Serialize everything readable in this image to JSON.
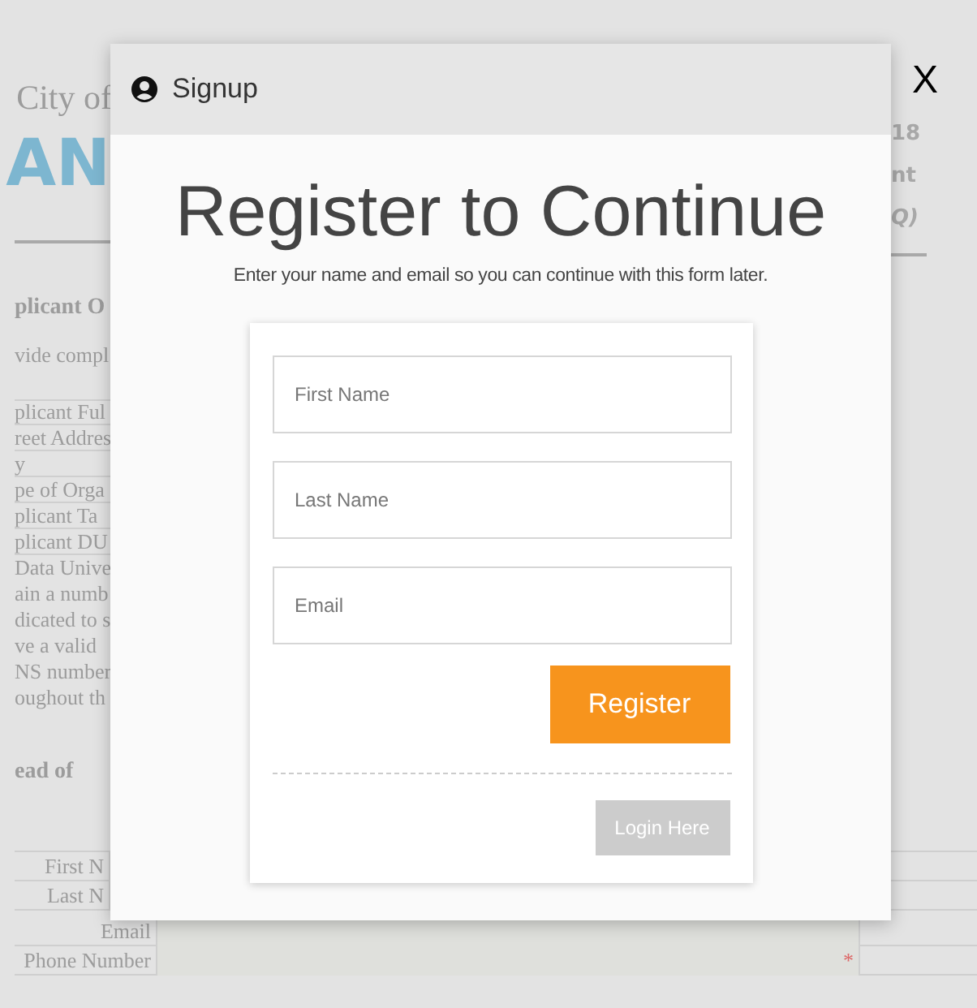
{
  "background_page": {
    "city_line": "City of",
    "logo_text": "AN",
    "right_lines": [
      "18",
      "nt",
      "Q)"
    ],
    "lines": [
      {
        "text": "plicant O",
        "kind": "heading"
      },
      {
        "text": "vide compl",
        "kind": "text"
      },
      {
        "text": "plicant Ful",
        "kind": "field"
      },
      {
        "text": "reet Addres",
        "kind": "field"
      },
      {
        "text": "y",
        "kind": "field"
      },
      {
        "text": "pe of Orga",
        "kind": "field"
      },
      {
        "text": "plicant Ta",
        "kind": "field"
      },
      {
        "text": "plicant DU",
        "kind": "field"
      },
      {
        "text": "Data Unive",
        "kind": "text"
      },
      {
        "text": "ain a numb",
        "kind": "text"
      },
      {
        "text": "dicated to s",
        "kind": "text"
      },
      {
        "text": "ve a valid",
        "kind": "text"
      },
      {
        "text": "NS number",
        "kind": "text"
      },
      {
        "text": "oughout th",
        "kind": "text"
      },
      {
        "text": "ead of",
        "kind": "heading"
      }
    ],
    "contact_rows": [
      {
        "label": "First N"
      },
      {
        "label": "Last N"
      },
      {
        "label": "Email"
      },
      {
        "label": "Phone Number",
        "required_mark": "*"
      }
    ]
  },
  "dialog": {
    "title": "Signup",
    "heading": "Register to Continue",
    "subtitle": "Enter your name and email so you can continue with this form later.",
    "fields": [
      {
        "placeholder": "First Name"
      },
      {
        "placeholder": "Last Name"
      },
      {
        "placeholder": "Email"
      }
    ],
    "register_button": "Register",
    "login_button": "Login Here",
    "close": "X"
  }
}
